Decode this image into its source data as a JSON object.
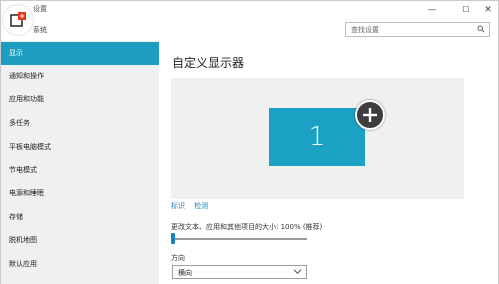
{
  "window": {
    "title": "设置",
    "controls": {
      "minimize": "—",
      "maximize": "☐",
      "close": "✕"
    }
  },
  "header": {
    "app_label": "系统",
    "search_placeholder": "查找设置"
  },
  "sidebar": {
    "items": [
      {
        "label": "显示",
        "active": true
      },
      {
        "label": "通知和操作"
      },
      {
        "label": "应用和功能"
      },
      {
        "label": "多任务"
      },
      {
        "label": "平板电脑模式"
      },
      {
        "label": "节电模式"
      },
      {
        "label": "电源和睡眠"
      },
      {
        "label": "存储"
      },
      {
        "label": "脱机地图"
      },
      {
        "label": "默认应用"
      }
    ]
  },
  "main": {
    "title": "自定义显示器",
    "monitor_number": "1",
    "links": {
      "identify": "标识",
      "detect": "检测"
    },
    "scale_label": "更改文本、应用和其他项目的大小: 100% (推荐)",
    "scale_value_percent": 100,
    "orientation_label": "方向",
    "orientation_value": "横向"
  },
  "colors": {
    "accent": "#1e9dc1",
    "monitor_tile": "#1aa1c3",
    "link": "#1a7fb5",
    "sidebar_bg": "#f0f0f0"
  },
  "icons": {
    "logo": "app-logo-icon",
    "plus": "plus-cursor-icon",
    "search": "search-icon",
    "dropdown": "chevron-down-icon"
  }
}
